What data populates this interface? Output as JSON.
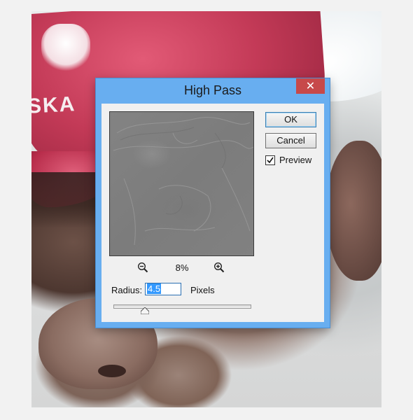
{
  "dialog": {
    "title": "High Pass",
    "close_label": "✕",
    "ok_label": "OK",
    "cancel_label": "Cancel",
    "preview_label": "Preview",
    "preview_checked": true,
    "zoom_level": "8%",
    "radius_label": "Radius:",
    "radius_value": "4.5",
    "radius_unit": "Pixels",
    "radius_slider_fraction": 0.23
  },
  "photo": {
    "hat_text": "SKA"
  },
  "colors": {
    "titlebar": "#68aef0",
    "close_button": "#c7494a",
    "input_selection": "#3399ff"
  },
  "icons": [
    "zoom-out-icon",
    "zoom-in-icon",
    "checkmark-icon",
    "close-icon"
  ]
}
